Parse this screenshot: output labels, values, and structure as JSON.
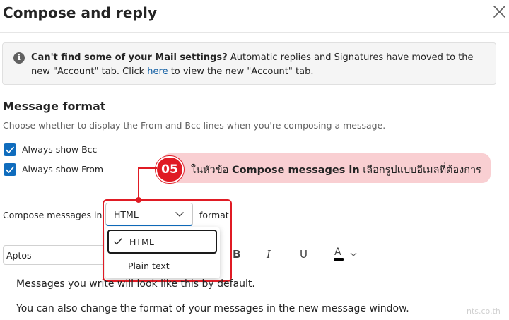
{
  "header": {
    "title": "Compose and reply",
    "close_icon": "close-icon"
  },
  "banner": {
    "icon": "info-icon",
    "icon_glyph": "i",
    "bold_text": "Can't find some of your Mail settings?",
    "text_before_link": " Automatic replies and Signatures have moved to the new \"Account\" tab. Click ",
    "link_text": "here",
    "text_after_link": " to view the new \"Account\" tab."
  },
  "message_format": {
    "title": "Message format",
    "description": "Choose whether to display the From and Bcc lines when you're composing a message.",
    "always_show_bcc": {
      "label": "Always show Bcc",
      "checked": true
    },
    "always_show_from": {
      "label": "Always show From",
      "checked": true
    },
    "compose_label": "Compose messages in",
    "format_selected": "HTML",
    "format_suffix": "format",
    "dropdown_options": [
      {
        "label": "HTML",
        "selected": true
      },
      {
        "label": "Plain text",
        "selected": false
      }
    ]
  },
  "callout": {
    "number": "05",
    "text_before": "ในหัวข้อ ",
    "text_bold": "Compose messages in",
    "text_after": " เลือกรูปแบบอีเมลที่ต้องการ",
    "color": "#e01b24",
    "background": "#f9cfd2"
  },
  "toolbar": {
    "font_name": "Aptos",
    "bold_glyph": "B",
    "italic_glyph": "I",
    "underline_glyph": "U",
    "font_color_glyph": "A"
  },
  "preview": {
    "line1": "Messages you write will look like this by default.",
    "line2": "You can also change the format of your messages in the new message window."
  },
  "watermark": "nts.co.th",
  "colors": {
    "accent": "#0f6cbd",
    "link": "#115ea3",
    "annotation_red": "#e01b24"
  }
}
